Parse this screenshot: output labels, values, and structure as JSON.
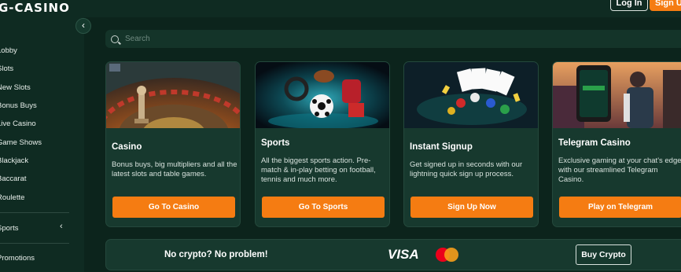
{
  "header": {
    "logo_text": "G-CASINO",
    "login_label": "Log In",
    "signup_label": "Sign Up"
  },
  "sidebar": {
    "items": [
      {
        "label": "Lobby"
      },
      {
        "label": "Slots"
      },
      {
        "label": "New Slots"
      },
      {
        "label": "Bonus Buys"
      },
      {
        "label": "Live Casino"
      },
      {
        "label": "Game Shows"
      },
      {
        "label": "Blackjack"
      },
      {
        "label": "Baccarat"
      },
      {
        "label": "Roulette"
      }
    ],
    "sports_label": "Sports",
    "promotions_label": "Promotions"
  },
  "search": {
    "placeholder": "Search"
  },
  "cards": [
    {
      "title": "Casino",
      "description": "Bonus buys, big multipliers and all the latest slots and table games.",
      "button": "Go To Casino",
      "icon": "roulette-image"
    },
    {
      "title": "Sports",
      "description": "All the biggest sports action. Pre-match & in-play betting on football, tennis and much more.",
      "button": "Go To Sports",
      "icon": "sports-image"
    },
    {
      "title": "Instant Signup",
      "description": "Get signed up in seconds with our lightning quick sign up process.",
      "button": "Sign Up Now",
      "icon": "cards-chips-image"
    },
    {
      "title": "Telegram Casino",
      "description": "Exclusive gaming at your chat's edge with our streamlined Telegram Casino.",
      "button": "Play on Telegram",
      "icon": "telegram-image"
    }
  ],
  "promo": {
    "text": "No crypto? No problem!",
    "visa_label": "VISA",
    "buy_label": "Buy Crypto"
  },
  "colors": {
    "accent": "#f57c12",
    "background": "#0f2b22",
    "card": "#17392e"
  }
}
